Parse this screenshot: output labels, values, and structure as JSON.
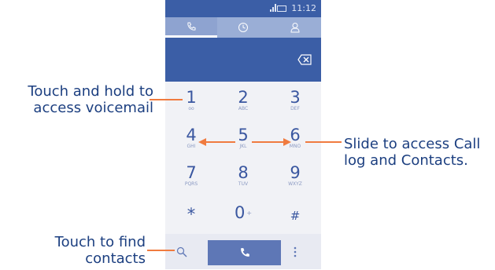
{
  "callouts": {
    "voicemail": "Touch and hold to access voicemail",
    "slide": "Slide to access Call log and Contacts.",
    "find": "Touch to find contacts"
  },
  "status": {
    "time": "11:12"
  },
  "tabs": [
    {
      "icon": "phone-icon",
      "active": true
    },
    {
      "icon": "clock-icon",
      "active": false
    },
    {
      "icon": "person-icon",
      "active": false
    }
  ],
  "keys": [
    {
      "digit": "1",
      "letters": "oo"
    },
    {
      "digit": "2",
      "letters": "ABC"
    },
    {
      "digit": "3",
      "letters": "DEF"
    },
    {
      "digit": "4",
      "letters": "GHI"
    },
    {
      "digit": "5",
      "letters": "JKL"
    },
    {
      "digit": "6",
      "letters": "MNO"
    },
    {
      "digit": "7",
      "letters": "PQRS"
    },
    {
      "digit": "8",
      "letters": "TUV"
    },
    {
      "digit": "9",
      "letters": "WXYZ"
    },
    {
      "digit": "*",
      "letters": ""
    },
    {
      "digit": "0",
      "letters": "+"
    },
    {
      "digit": "#",
      "letters": ""
    }
  ],
  "colors": {
    "accent": "#3b5ea6",
    "callout_text": "#1c3f80",
    "callout_line": "#f07b3f"
  }
}
